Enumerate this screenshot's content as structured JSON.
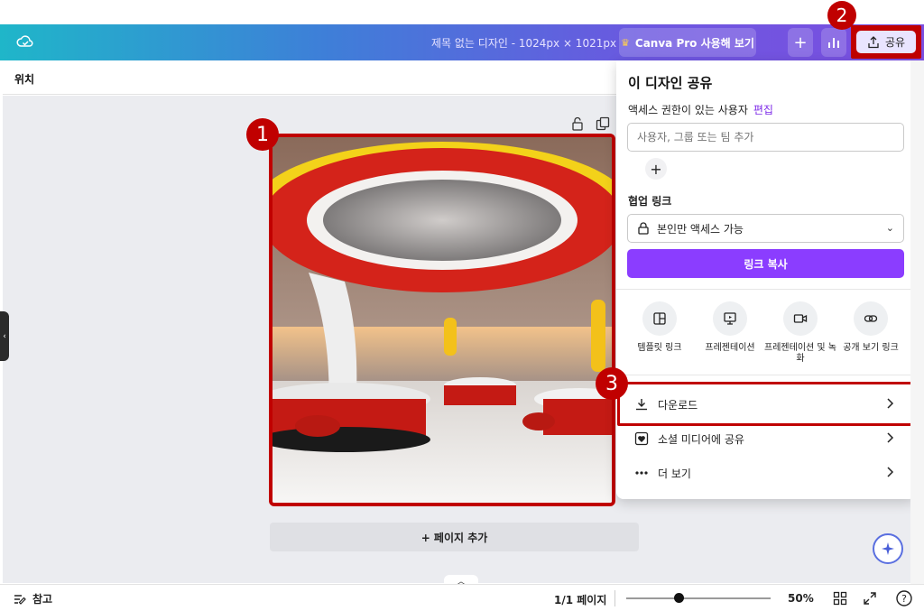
{
  "header": {
    "doc_title": "제목 없는 디자인 - 1024px × 1021px",
    "pro_button": "Canva Pro 사용해 보기",
    "share_button": "공유"
  },
  "position_bar": {
    "label": "위치"
  },
  "canvas": {
    "add_page": "+ 페이지 추가"
  },
  "share_panel": {
    "title": "이 디자인 공유",
    "access_label": "액세스 권한이 있는 사용자",
    "edit_link": "편집",
    "user_input_placeholder": "사용자, 그룹 또는 팀 추가",
    "collab_label": "협업 링크",
    "access_option": "본인만 액세스 가능",
    "copy_link": "링크 복사",
    "options": [
      {
        "label": "템플릿 링크",
        "icon": "template-icon"
      },
      {
        "label": "프레젠테이션",
        "icon": "presentation-icon"
      },
      {
        "label": "프레젠테이션 및 녹화",
        "icon": "video-icon"
      },
      {
        "label": "공개 보기 링크",
        "icon": "link-icon"
      }
    ],
    "rows": [
      {
        "label": "다운로드",
        "icon": "download-icon"
      },
      {
        "label": "소셜 미디어에 공유",
        "icon": "heart-icon"
      },
      {
        "label": "더 보기",
        "icon": "more-icon"
      }
    ]
  },
  "badges": {
    "one": "1",
    "two": "2",
    "three": "3"
  },
  "bottom_bar": {
    "notes": "참고",
    "page_count": "1/1 페이지",
    "zoom_percent": 50,
    "zoom": "50%"
  },
  "colors": {
    "accent": "#8b3dff",
    "highlight": "#c00000"
  }
}
